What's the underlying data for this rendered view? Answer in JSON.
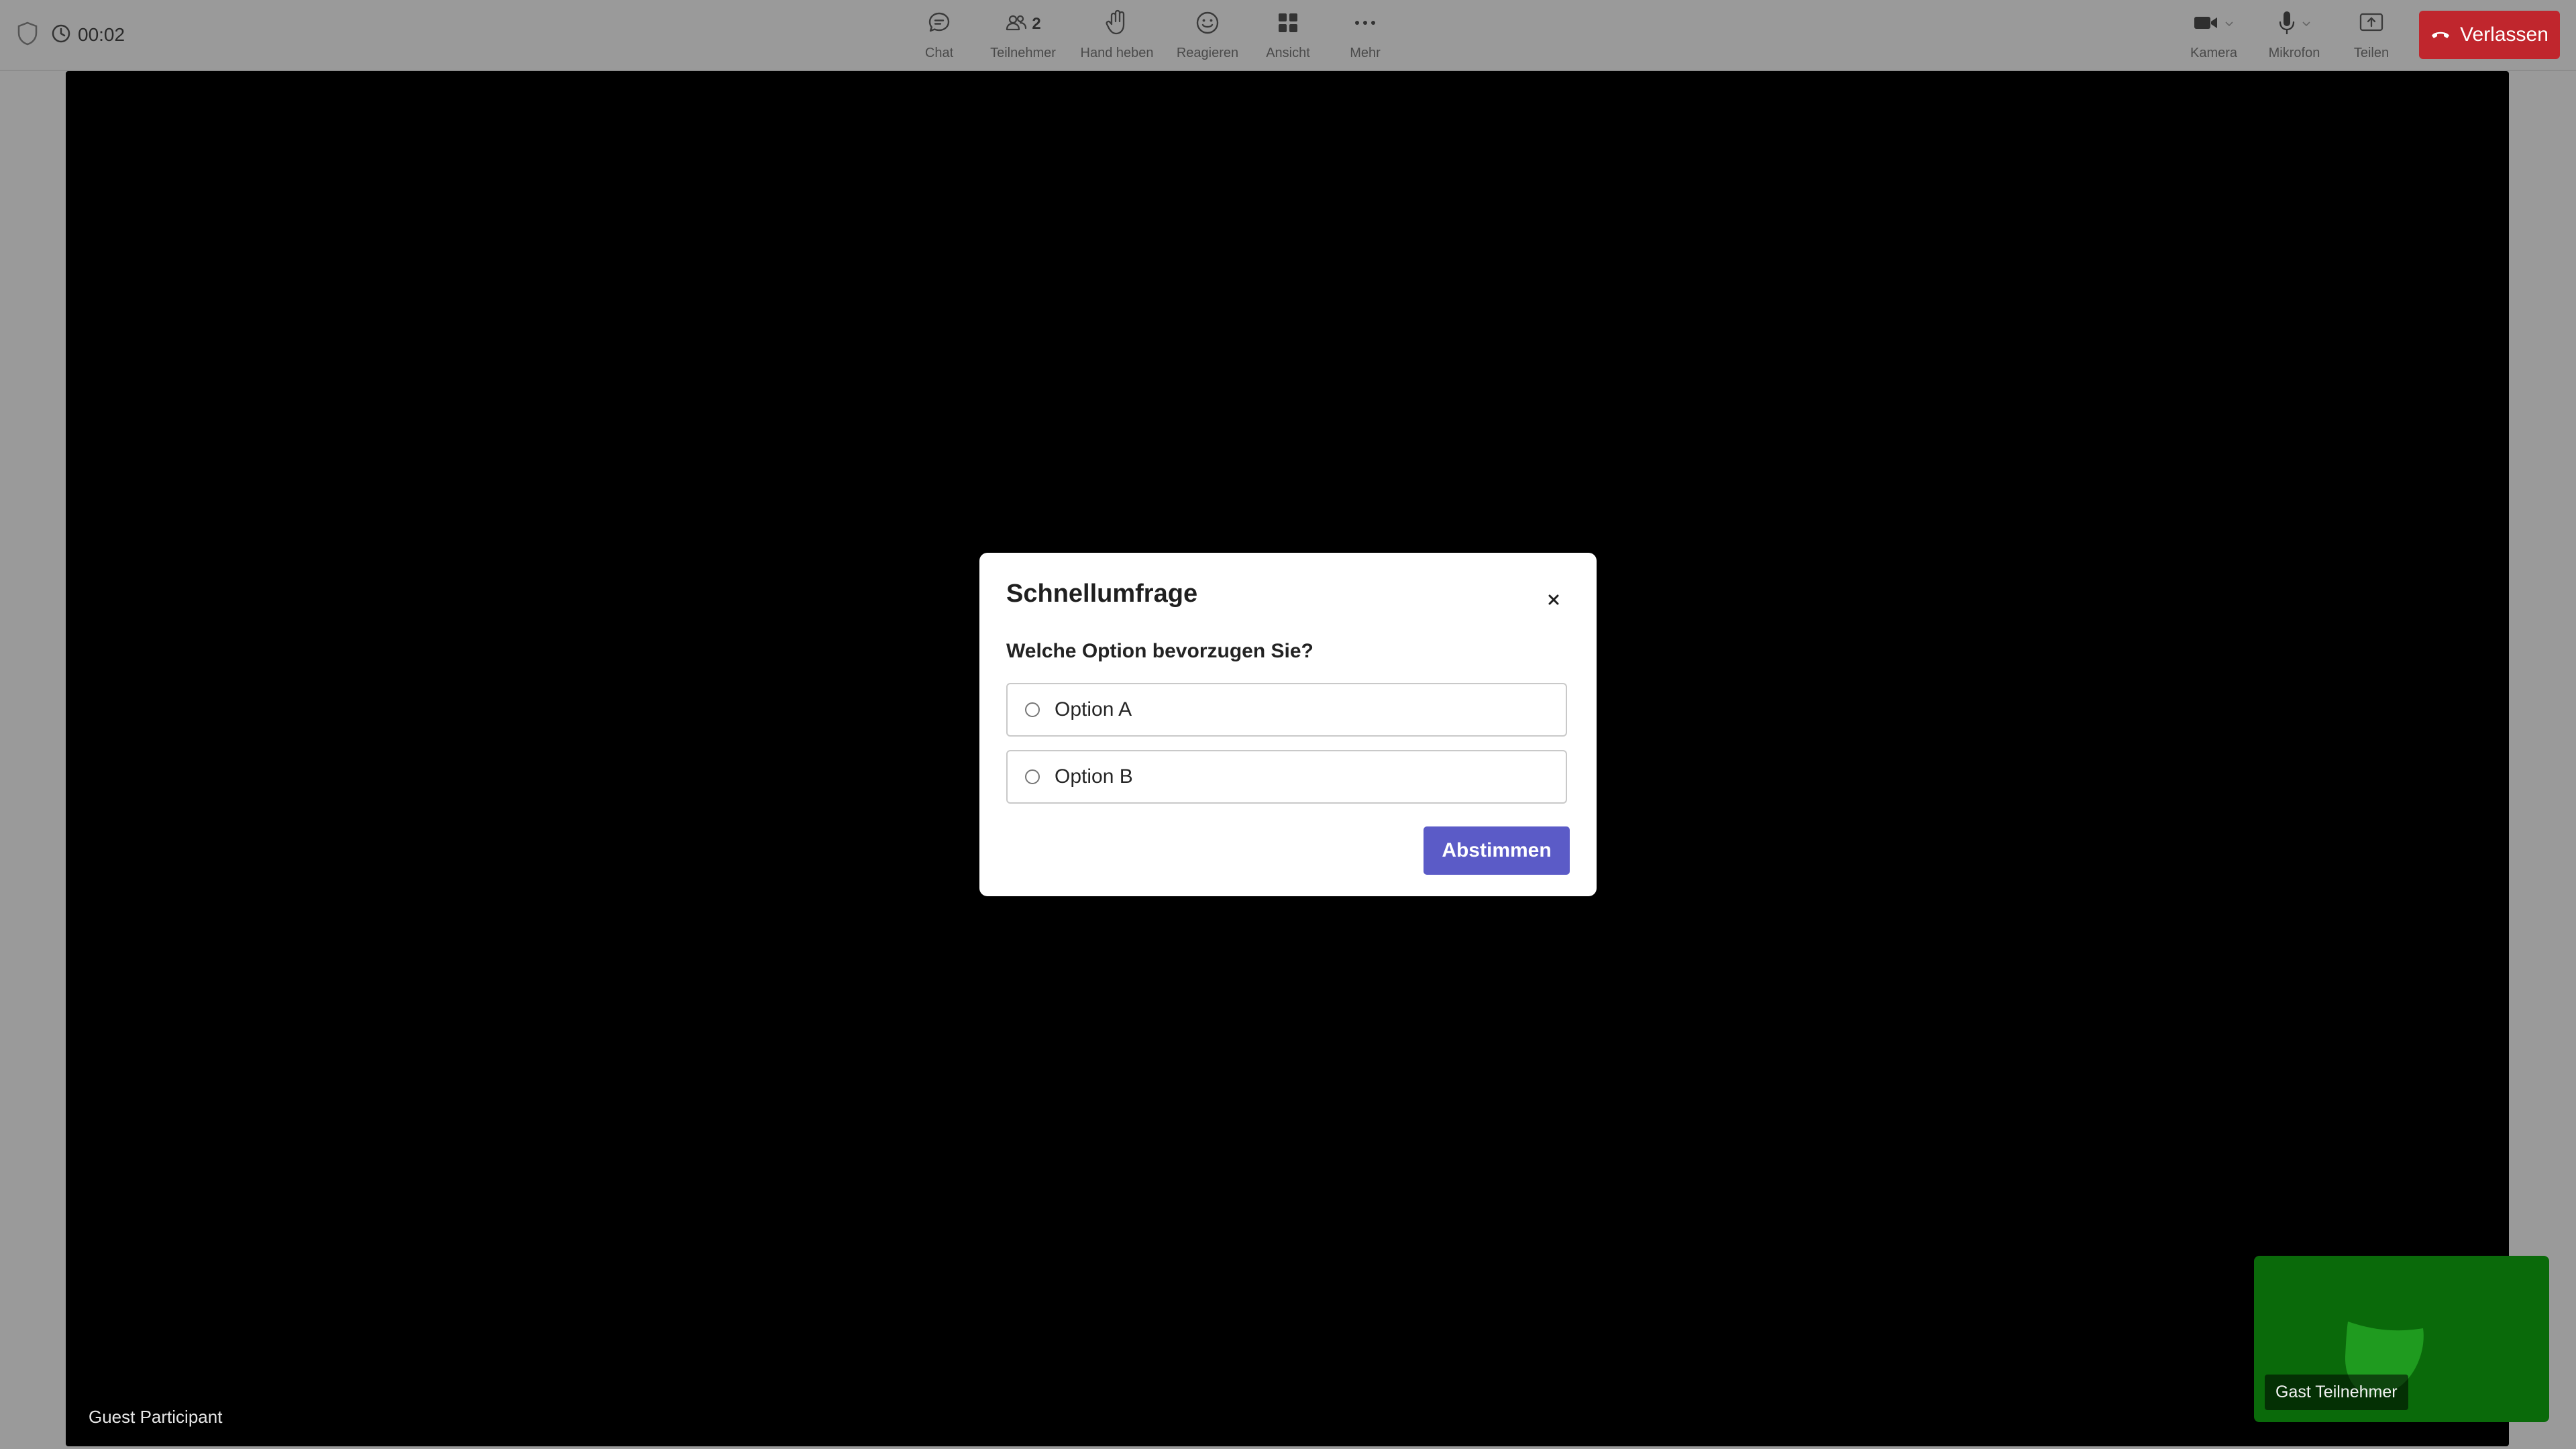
{
  "meeting": {
    "timer": "00:02",
    "speaker_name": "Guest Participant"
  },
  "toolbar": {
    "center": [
      {
        "label": "Chat",
        "icon": "chat-icon"
      },
      {
        "label": "Teilnehmer",
        "icon": "people-icon",
        "count": "2"
      },
      {
        "label": "Hand heben",
        "icon": "hand-icon"
      },
      {
        "label": "Reagieren",
        "icon": "smiley-icon"
      },
      {
        "label": "Ansicht",
        "icon": "grid-icon"
      },
      {
        "label": "Mehr",
        "icon": "more-icon"
      }
    ],
    "right": [
      {
        "label": "Kamera",
        "icon": "camera-icon"
      },
      {
        "label": "Mikrofon",
        "icon": "mic-icon"
      },
      {
        "label": "Teilen",
        "icon": "share-icon"
      }
    ],
    "leave_label": "Verlassen"
  },
  "self_view": {
    "label": "Gast Teilnehmer"
  },
  "poll": {
    "title": "Schnellumfrage",
    "question": "Welche Option bevorzugen Sie?",
    "options": [
      {
        "label": "Option A"
      },
      {
        "label": "Option B"
      }
    ],
    "submit_label": "Abstimmen"
  },
  "colors": {
    "leave": "#c0262d",
    "submit": "#5b5bc7",
    "self_view_bg": "#0a6a0a"
  }
}
